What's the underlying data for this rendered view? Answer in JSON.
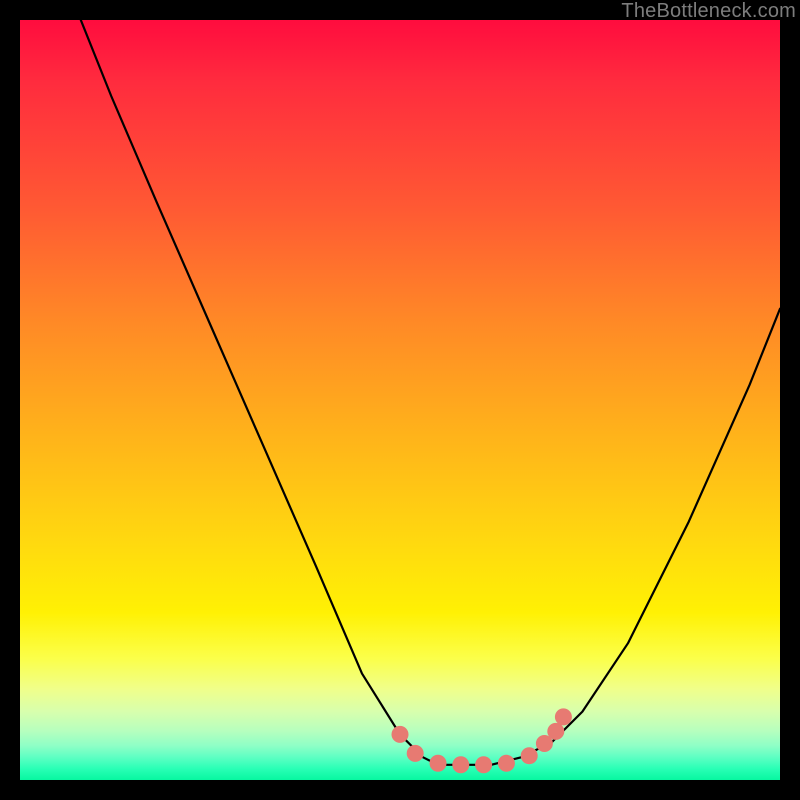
{
  "watermark": "TheBottleneck.com",
  "chart_data": {
    "type": "line",
    "title": "",
    "xlabel": "",
    "ylabel": "",
    "xlim": [
      0,
      100
    ],
    "ylim": [
      0,
      100
    ],
    "grid": false,
    "legend": false,
    "background_gradient": {
      "top": "#ff0c3e",
      "bottom": "#07f7a0",
      "stops": [
        "red",
        "orange",
        "yellow",
        "green"
      ]
    },
    "series": [
      {
        "name": "bottleneck-curve",
        "color": "#000000",
        "x": [
          8,
          12,
          18,
          25,
          32,
          39,
          45,
          50,
          53,
          55,
          58,
          62,
          66,
          70,
          74,
          80,
          88,
          96,
          100
        ],
        "y": [
          100,
          90,
          76,
          60,
          44,
          28,
          14,
          6,
          3,
          2,
          2,
          2,
          3,
          5,
          9,
          18,
          34,
          52,
          62
        ]
      }
    ],
    "markers": {
      "name": "highlight-dots",
      "color": "#e77a72",
      "points": [
        {
          "x": 50,
          "y": 6
        },
        {
          "x": 52,
          "y": 3.5
        },
        {
          "x": 55,
          "y": 2.2
        },
        {
          "x": 58,
          "y": 2.0
        },
        {
          "x": 61,
          "y": 2.0
        },
        {
          "x": 64,
          "y": 2.2
        },
        {
          "x": 67,
          "y": 3.2
        },
        {
          "x": 69,
          "y": 4.8
        },
        {
          "x": 70.5,
          "y": 6.4
        },
        {
          "x": 71.5,
          "y": 8.3
        }
      ]
    }
  }
}
